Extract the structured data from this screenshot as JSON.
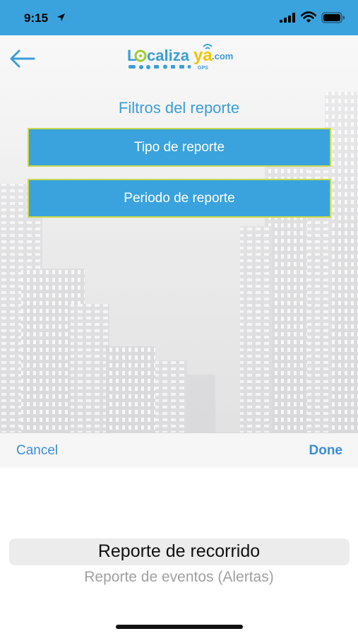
{
  "status_bar": {
    "time": "9:15",
    "background": "#3aa3dd"
  },
  "header": {
    "back_icon": "arrow-left-icon",
    "logo": {
      "text_lo": "Lo",
      "text_caliza": "caliza",
      "text_ya": "ya",
      "text_com": ".com",
      "text_gps": "GPS"
    }
  },
  "filters": {
    "title": "Filtros del reporte",
    "type_button": "Tipo de reporte",
    "period_button": "Periodo de reporte",
    "button_color": "#3aa3dd",
    "button_border": "#c8d94a"
  },
  "picker_toolbar": {
    "cancel_label": "Cancel",
    "done_label": "Done"
  },
  "picker": {
    "selected": "Reporte de recorrido",
    "next_option": "Reporte de eventos (Alertas)"
  }
}
